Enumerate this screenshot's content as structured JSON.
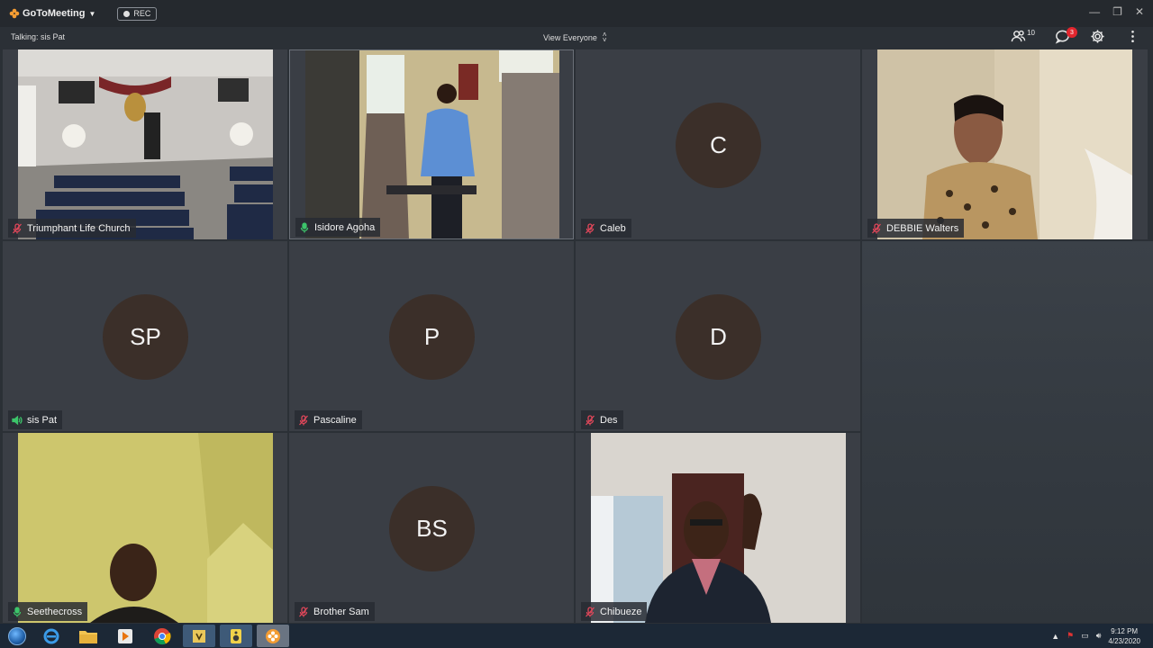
{
  "app": {
    "name": "GoToMeeting",
    "rec_label": "REC"
  },
  "infobar": {
    "talking": "Talking: sis Pat",
    "view": "View Everyone",
    "attendee_count": "10",
    "chat_badge": "3"
  },
  "tiles": [
    {
      "name": "Triumphant Life Church",
      "mic": "muted",
      "initials": ""
    },
    {
      "name": "Isidore Agoha",
      "mic": "active",
      "initials": ""
    },
    {
      "name": "Caleb",
      "mic": "muted",
      "initials": "C"
    },
    {
      "name": "DEBBIE Walters",
      "mic": "muted",
      "initials": ""
    },
    {
      "name": "sis Pat",
      "mic": "speaking",
      "initials": "SP"
    },
    {
      "name": "Pascaline",
      "mic": "muted",
      "initials": "P"
    },
    {
      "name": "Des",
      "mic": "muted",
      "initials": "D"
    },
    {
      "name": "Seethecross",
      "mic": "active",
      "initials": ""
    },
    {
      "name": "Brother Sam",
      "mic": "muted",
      "initials": "BS"
    },
    {
      "name": "Chibueze",
      "mic": "muted",
      "initials": ""
    }
  ],
  "taskbar": {
    "apps": [
      "start-orb",
      "internet-explorer-icon",
      "file-explorer-icon",
      "media-player-icon",
      "chrome-icon",
      "archive-icon",
      "speaker-app-icon",
      "gotomeeting-icon"
    ],
    "time": "9:12 PM",
    "date": "4/23/2020"
  },
  "colors": {
    "muted": "#e0475a",
    "active": "#3cc46a",
    "accent": "#f39c33"
  }
}
